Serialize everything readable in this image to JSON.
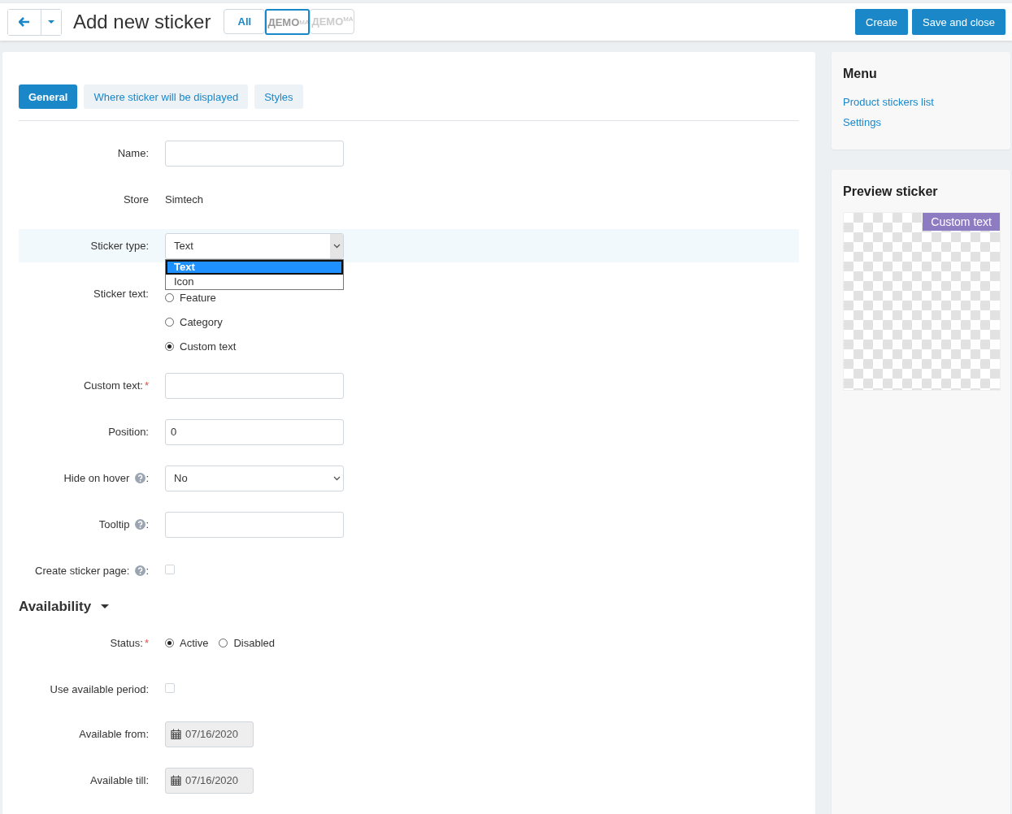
{
  "toolbar": {
    "title": "Add new sticker",
    "storefronts": [
      {
        "label": "All",
        "kind": "text",
        "selected": false
      },
      {
        "label": "ДЕМО",
        "sup": "МА",
        "kind": "logo",
        "selected": true
      },
      {
        "label": "ДЕМО",
        "sup": "МА",
        "kind": "logo",
        "selected": false
      }
    ],
    "buttons": [
      "Create",
      "Save and close"
    ]
  },
  "tabs": [
    {
      "label": "General",
      "selected": true
    },
    {
      "label": "Where sticker will be displayed",
      "selected": false
    },
    {
      "label": "Styles",
      "selected": false
    }
  ],
  "fields": [
    {
      "label": "Name:",
      "kind": "input"
    },
    {
      "label": "Store",
      "kind": "text",
      "value": "Simtech"
    },
    {
      "label": "Sticker type:",
      "kind": "select",
      "value": "Text",
      "highlighted": true,
      "open": true,
      "options": [
        {
          "label": "Text",
          "selected": true
        },
        {
          "label": "Icon",
          "selected": false
        }
      ]
    },
    {
      "label": "Sticker text:",
      "kind": "radios",
      "options": [
        {
          "label": "Feature",
          "selected": false
        },
        {
          "label": "Category",
          "selected": false
        },
        {
          "label": "Custom text",
          "selected": true
        }
      ]
    },
    {
      "label": "Custom text:",
      "kind": "input",
      "required_mark": "*"
    },
    {
      "label": "Position:",
      "kind": "input",
      "value": "0"
    },
    {
      "label": "Hide on hover",
      "kind": "select",
      "value": "No",
      "help_suffix": ":"
    },
    {
      "label": "Tooltip",
      "kind": "input",
      "help_suffix": ":"
    },
    {
      "label": "Create sticker page:",
      "kind": "checkbox",
      "checked": false,
      "help_suffix": ":"
    }
  ],
  "availability": {
    "title": "Availability",
    "expanded": true,
    "fields": [
      {
        "label": "Status:",
        "kind": "radio-row",
        "required_mark": "*",
        "options": [
          {
            "label": "Active",
            "selected": true
          },
          {
            "label": "Disabled",
            "selected": false
          }
        ]
      },
      {
        "label": "Use available period:",
        "kind": "checkbox",
        "checked": false
      },
      {
        "label": "Available from:",
        "kind": "date",
        "value": "07/16/2020"
      },
      {
        "label": "Available till:",
        "kind": "date",
        "value": "07/16/2020"
      }
    ]
  },
  "menu": {
    "title": "Menu",
    "links": [
      "Product stickers list",
      "Settings"
    ]
  },
  "preview": {
    "title": "Preview sticker",
    "sticker": "Custom text",
    "color": "#8e7cc3"
  }
}
